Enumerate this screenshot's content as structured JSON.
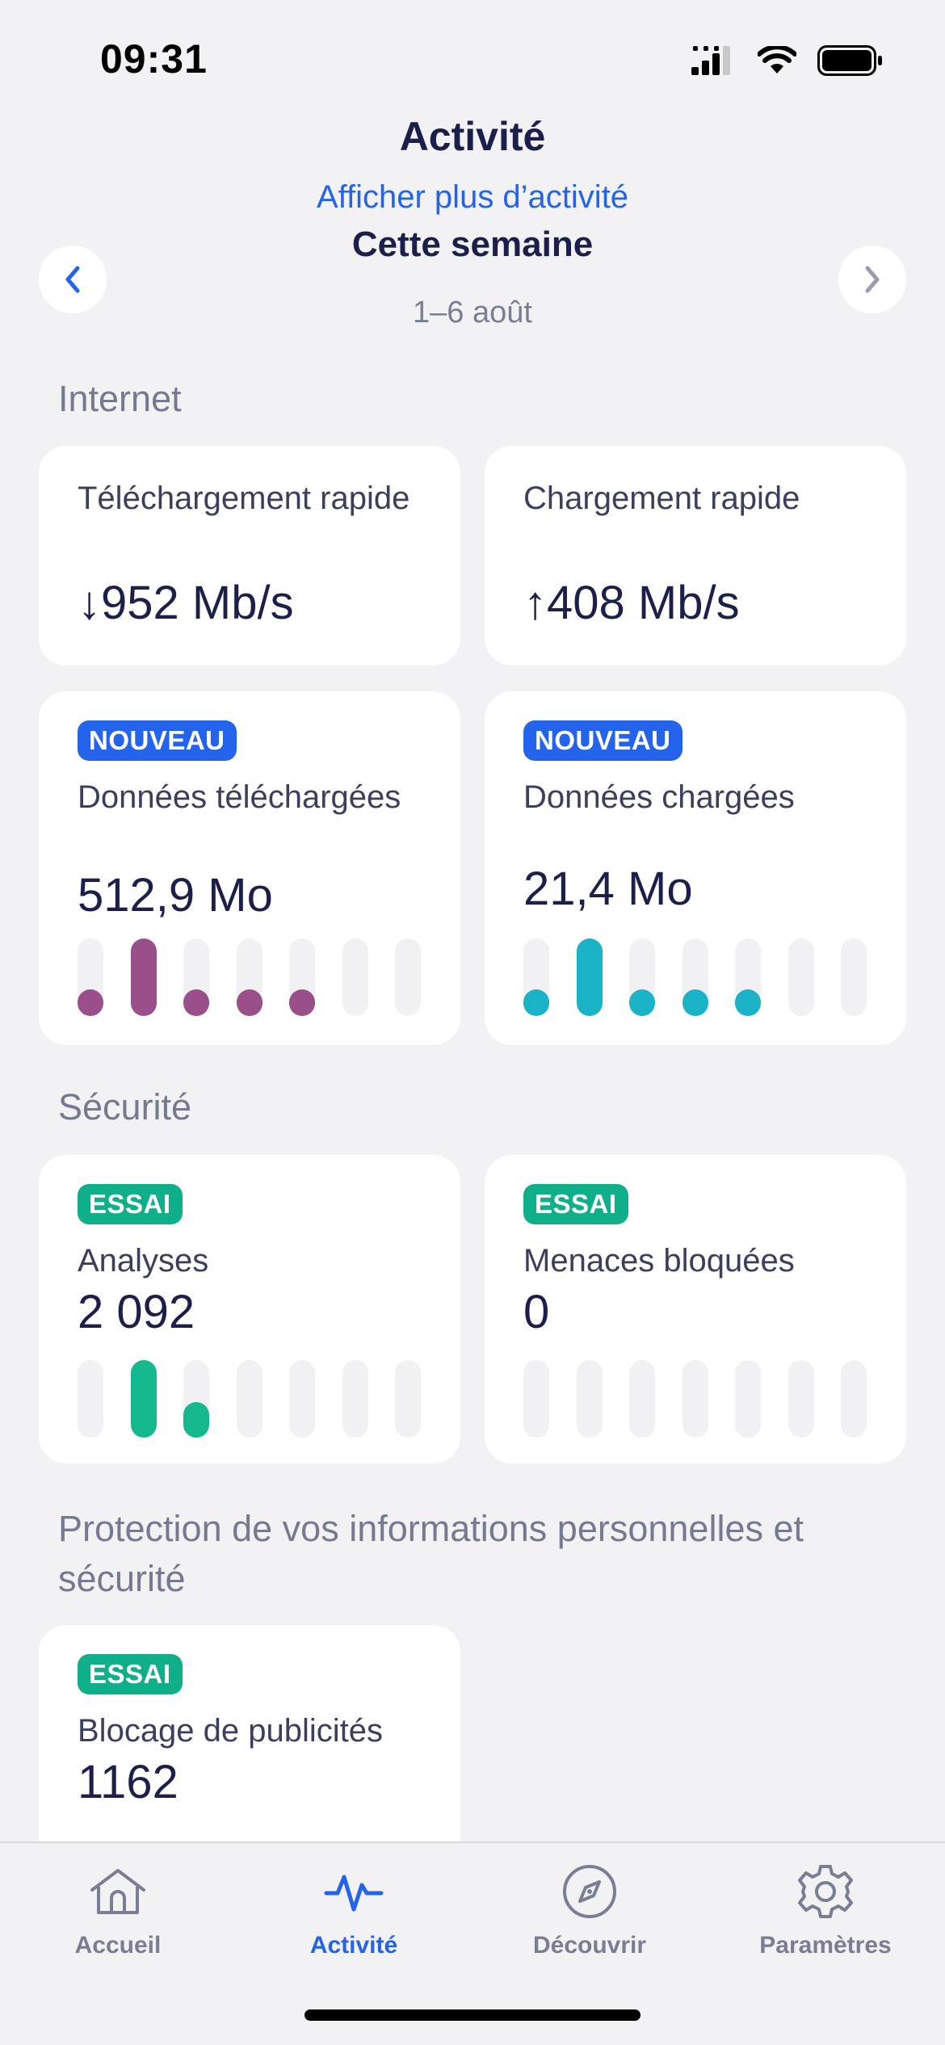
{
  "status_bar": {
    "time": "09:31"
  },
  "header": {
    "title": "Activité",
    "more_link": "Afficher plus d’activité",
    "period_title": "Cette semaine",
    "period_range": "1–6 août"
  },
  "colors": {
    "accent": "#2463eb",
    "trial_badge": "#0fb089",
    "downloaded_bars": "#9b4f8a",
    "uploaded_bars": "#19b2c7",
    "scans_bars": "#13b88c",
    "ads_bars": "#f09a3a"
  },
  "sections": {
    "internet": "Internet",
    "security": "Sécurité",
    "privacy": "Protection de vos informations personnelles et sécurité"
  },
  "cards": {
    "download_speed": {
      "label": "Téléchargement rapide",
      "value": "↓952 Mb/s"
    },
    "upload_speed": {
      "label": "Chargement rapide",
      "value": "↑408 Mb/s"
    },
    "data_downloaded": {
      "badge": "NOUVEAU",
      "label": "Données téléchargées",
      "value": "512,9 Mo",
      "daily_levels": [
        0.34,
        1.0,
        0.34,
        0.34,
        0.34,
        0,
        0
      ]
    },
    "data_uploaded": {
      "badge": "NOUVEAU",
      "label": "Données chargées",
      "value": "21,4 Mo",
      "daily_levels": [
        0.34,
        1.0,
        0.34,
        0.34,
        0.34,
        0,
        0
      ]
    },
    "scans": {
      "badge": "ESSAI",
      "label": "Analyses",
      "value": "2 092",
      "daily_levels": [
        0,
        1.0,
        0.46,
        0,
        0,
        0,
        0
      ]
    },
    "threats_blocked": {
      "badge": "ESSAI",
      "label": "Menaces bloquées",
      "value": "0",
      "daily_levels": [
        0,
        0,
        0,
        0,
        0,
        0,
        0
      ]
    },
    "ad_blocking": {
      "badge": "ESSAI",
      "label": "Blocage de publicités",
      "value": "1162"
    }
  },
  "tab_bar": {
    "tabs": [
      {
        "label": "Accueil",
        "icon": "home-icon"
      },
      {
        "label": "Activité",
        "icon": "activity-icon"
      },
      {
        "label": "Découvrir",
        "icon": "compass-icon"
      },
      {
        "label": "Paramètres",
        "icon": "gear-icon"
      }
    ],
    "active": "Activité"
  }
}
